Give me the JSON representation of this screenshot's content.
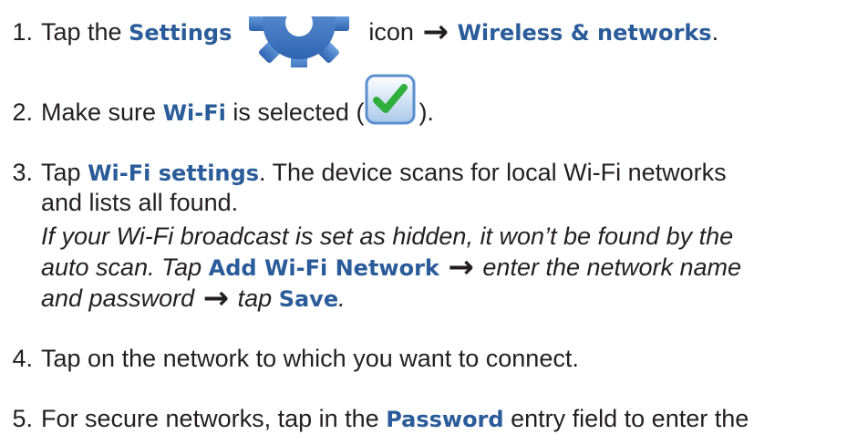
{
  "steps": [
    {
      "num": "1.",
      "t1": "Tap the",
      "k1": "Settings",
      "t2": "icon",
      "k2": "Wireless & networks",
      "t3": "."
    },
    {
      "num": "2.",
      "t1": "Make sure",
      "k1": "Wi-Fi",
      "t2": "is selected (",
      "t3": ")."
    },
    {
      "num": "3.",
      "t1": "Tap",
      "k1": "Wi-Fi settings",
      "t2": ". The device scans for local Wi-Fi networks",
      "line2": "and lists all found.",
      "note1": "If your Wi-Fi broadcast is set as hidden, it won’t be found by the",
      "note2a": "auto scan. Tap",
      "note2k": "Add Wi-Fi Network",
      "note2b": "enter the network name",
      "note3a": "and password",
      "note3b": "tap",
      "note3k": "Save",
      "note3c": "."
    },
    {
      "num": "4.",
      "t1": "Tap on the network to which you want to connect."
    },
    {
      "num": "5.",
      "t1": "For secure networks, tap in the",
      "k1": "Password",
      "t2": "entry field to enter the"
    }
  ],
  "icons": {
    "arrow_glyph": "→",
    "settings": "gear-icon",
    "checkbox": "checkbox-checked-icon",
    "colors": {
      "keyword": "#2a5c9a",
      "gear": "#3d77c4",
      "check": "#2fae3c"
    }
  }
}
